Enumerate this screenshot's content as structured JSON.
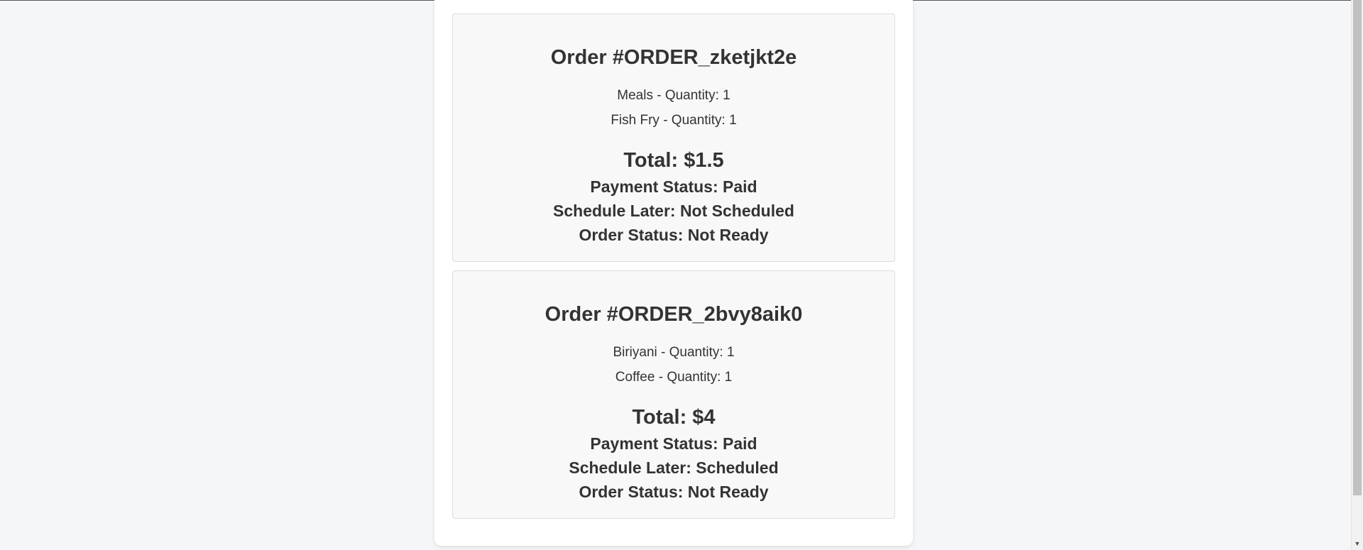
{
  "orders": [
    {
      "title": "Order #ORDER_zketjkt2e",
      "items": [
        "Meals - Quantity: 1",
        "Fish Fry - Quantity: 1"
      ],
      "total": "Total: $1.5",
      "payment_status": "Payment Status: Paid",
      "schedule_later": "Schedule Later: Not Scheduled",
      "order_status": "Order Status: Not Ready"
    },
    {
      "title": "Order #ORDER_2bvy8aik0",
      "items": [
        "Biriyani - Quantity: 1",
        "Coffee - Quantity: 1"
      ],
      "total": "Total: $4",
      "payment_status": "Payment Status: Paid",
      "schedule_later": "Schedule Later: Scheduled",
      "order_status": "Order Status: Not Ready"
    }
  ],
  "scrollbar": {
    "down_arrow_icon": "chevron-down-icon"
  },
  "colors": {
    "background": "#f5f6f8",
    "card_background": "#f8f8f8",
    "text": "#333333"
  }
}
